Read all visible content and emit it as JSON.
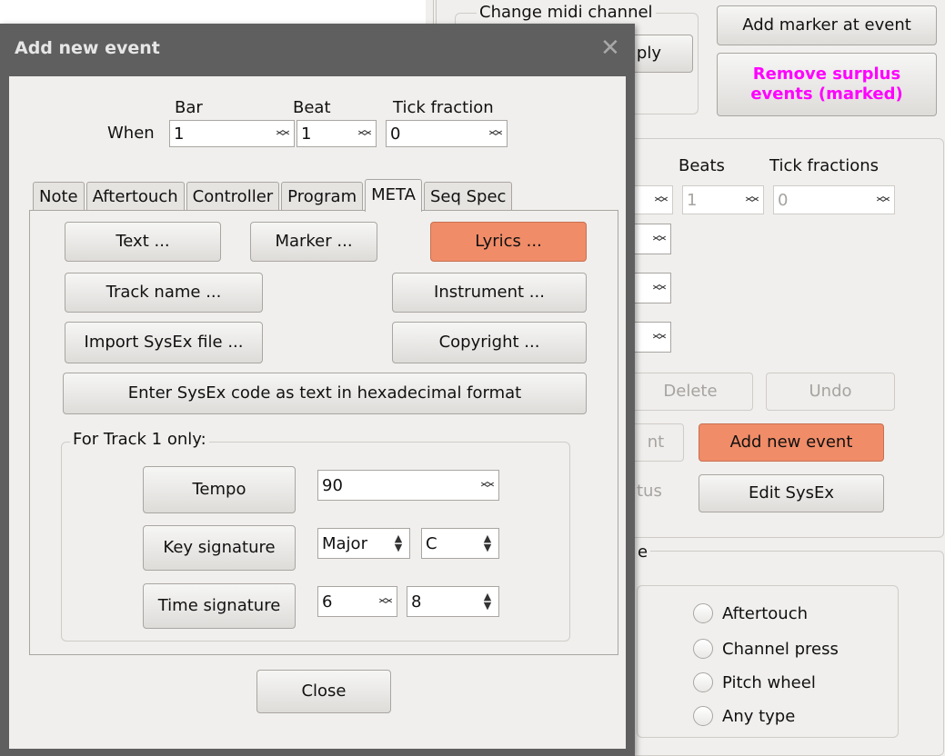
{
  "background": {
    "midi_group": {
      "legend": "Change midi channel",
      "apply_label": "ply"
    },
    "add_marker_label": "Add marker at event",
    "remove_surplus_label": "Remove surplus events (marked)",
    "position_headers": {
      "beats": "Beats",
      "tick_fractions": "Tick fractions"
    },
    "beats_value": "1",
    "tick_fractions_value": "0",
    "delete_label": "Delete",
    "undo_label": "Undo",
    "partial_button_label": "nt",
    "add_new_event_label": "Add new event",
    "partial_status_label": "tus",
    "edit_sysex_label": "Edit SysEx",
    "type_group_legend_partial": "e",
    "radios": [
      "Aftertouch",
      "Channel press",
      "Pitch wheel",
      "Any type"
    ]
  },
  "dialog": {
    "title": "Add new event",
    "close_glyph": "✕",
    "when": {
      "label": "When",
      "bar_label": "Bar",
      "beat_label": "Beat",
      "tick_label": "Tick fraction",
      "bar_value": "1",
      "beat_value": "1",
      "tick_value": "0"
    },
    "tabs": [
      "Note",
      "Aftertouch",
      "Controller",
      "Program",
      "META",
      "Seq Spec"
    ],
    "active_tab": "META",
    "meta": {
      "text_button": "Text ...",
      "marker_button": "Marker ...",
      "lyrics_button": "Lyrics ...",
      "track_name_button": "Track name ...",
      "instrument_button": "Instrument ...",
      "import_sysex_button": "Import SysEx file ...",
      "copyright_button": "Copyright ...",
      "sysex_hex_button": "Enter SysEx code as text in hexadecimal format"
    },
    "track1": {
      "legend": "For Track 1 only:",
      "tempo_button": "Tempo",
      "tempo_value": "90",
      "key_signature_button": "Key signature",
      "key_mode_value": "Major",
      "key_note_value": "C",
      "time_signature_button": "Time signature",
      "time_numerator_value": "6",
      "time_denominator_value": "8"
    },
    "close_button": "Close"
  },
  "colors": {
    "accent_orange": "#f08c68",
    "magenta_text": "#ff00ff",
    "dialog_frame": "#5f5f5f",
    "window_bg": "#f0efed"
  }
}
